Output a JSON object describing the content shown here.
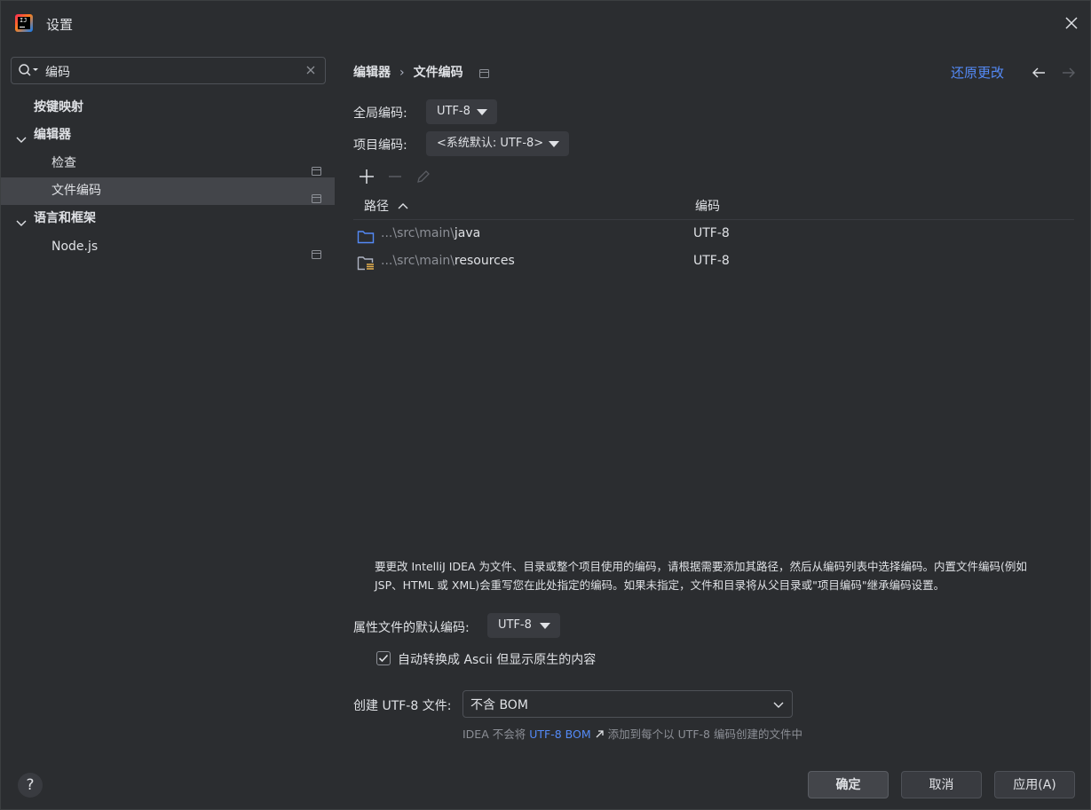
{
  "window": {
    "title": "设置"
  },
  "sidebar": {
    "search_value": "编码",
    "items": [
      {
        "label": "按键映射"
      },
      {
        "label": "编辑器"
      },
      {
        "label": "检查"
      },
      {
        "label": "文件编码"
      },
      {
        "label": "语言和框架"
      },
      {
        "label": "Node.js"
      }
    ]
  },
  "header": {
    "breadcrumb": [
      "编辑器",
      "›",
      "文件编码"
    ],
    "reset_label": "还原更改"
  },
  "form": {
    "global_label": "全局编码:",
    "global_value": "UTF-8",
    "project_label": "项目编码:",
    "project_value": "<系统默认: UTF-8>"
  },
  "table": {
    "col_path": "路径",
    "col_encoding": "编码",
    "rows": [
      {
        "prefix": "...\\src\\main\\",
        "name": "java",
        "encoding": "UTF-8"
      },
      {
        "prefix": "...\\src\\main\\",
        "name": "resources",
        "encoding": "UTF-8"
      }
    ]
  },
  "hint": {
    "line1": "要更改 IntelliJ IDEA 为文件、目录或整个项目使用的编码，请根据需要添加其路径，然后从编码列表中选择编码。内置文件编码(例如",
    "line2": "JSP、HTML 或 XML)会重写您在此处指定的编码。如果未指定，文件和目录将从父目录或\"项目编码\"继承编码设置。"
  },
  "properties": {
    "label": "属性文件的默认编码:",
    "value": "UTF-8",
    "checkbox_label": "自动转换成 Ascii 但显示原生的内容",
    "checkbox_checked": true
  },
  "bom": {
    "label": "创建 UTF-8 文件:",
    "value": "不含 BOM",
    "note_before": "IDEA 不会将",
    "note_link": "UTF-8 BOM",
    "note_after": "添加到每个以 UTF-8 编码创建的文件中"
  },
  "footer": {
    "help": "?",
    "ok": "确定",
    "cancel": "取消",
    "apply": "应用(A)"
  },
  "colors": {
    "accent": "#548af7",
    "selection": "#43454a",
    "background": "#2b2d30",
    "folder": "#548af7"
  }
}
